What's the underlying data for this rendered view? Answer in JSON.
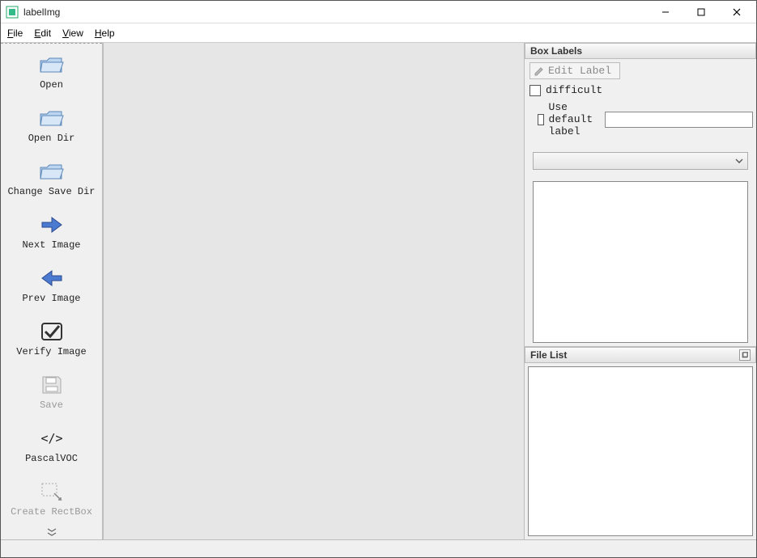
{
  "window": {
    "title": "labelImg",
    "controls": {
      "min": "–",
      "max": "☐",
      "close": "✕"
    }
  },
  "menu": {
    "file": "File",
    "edit": "Edit",
    "view": "View",
    "help": "Help"
  },
  "toolbar": {
    "open": "Open",
    "open_dir": "Open Dir",
    "change_save_dir": "Change Save Dir",
    "next_image": "Next Image",
    "prev_image": "Prev Image",
    "verify_image": "Verify Image",
    "save": "Save",
    "format": "PascalVOC",
    "create_rectbox": "Create RectBox"
  },
  "panels": {
    "box_labels": {
      "title": "Box Labels",
      "edit_label": "Edit Label",
      "difficult": "difficult",
      "use_default_label": "Use default label",
      "default_label_value": "",
      "combo_value": ""
    },
    "file_list": {
      "title": "File List"
    }
  },
  "state": {
    "save_enabled": false,
    "create_rectbox_enabled": false,
    "edit_label_enabled": false,
    "difficult_checked": false,
    "use_default_label_checked": false
  },
  "icons": {
    "app": "app-icon",
    "folder": "folder-icon",
    "arrow_right": "arrow-right-icon",
    "arrow_left": "arrow-left-icon",
    "check": "check-icon",
    "save": "save-icon",
    "code": "code-icon",
    "rect": "rect-icon",
    "pencil": "pencil-icon",
    "chevrons": "chevrons-icon",
    "combo_chevron": "chevron-down-icon",
    "undock": "undock-icon"
  }
}
